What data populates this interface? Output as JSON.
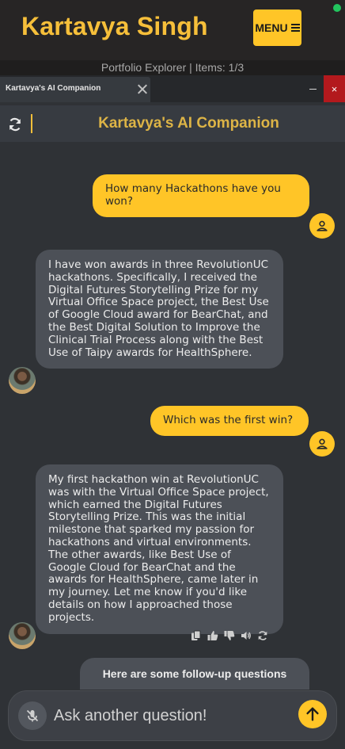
{
  "app": {
    "brand": "Kartavya Singh",
    "menu_label": "MENU",
    "subtitle": "Portfolio Explorer | Items: 1/3"
  },
  "window": {
    "tab_title": "Kartavya's AI Companion",
    "minimize_glyph": "–",
    "close_glyph": "×"
  },
  "chat": {
    "header_title": "Kartavya's AI Companion",
    "messages": [
      {
        "role": "user",
        "text": "How many Hackathons have you won?"
      },
      {
        "role": "bot",
        "text": "I have won awards in three RevolutionUC hackathons. Specifically, I received the Digital Futures Storytelling Prize for my Virtual Office Space project, the Best Use of Google Cloud award for BearChat, and the Best Digital Solution to Improve the Clinical Trial Process along with the Best Use of Taipy awards for HealthSphere."
      },
      {
        "role": "user",
        "text": "Which was the first win?"
      },
      {
        "role": "bot",
        "text": "My first hackathon win at RevolutionUC was with the Virtual Office Space project, which earned the Digital Futures Storytelling Prize. This was the initial milestone that sparked my passion for hackathons and virtual environments. The other awards, like Best Use of Google Cloud for BearChat and the awards for HealthSphere, came later in my journey. Let me know if you'd like details on how I approached those projects."
      }
    ],
    "action_icons": [
      "copy-icon",
      "thumbs-up-icon",
      "thumbs-down-icon",
      "speaker-icon",
      "regenerate-icon"
    ],
    "followup_heading": "Here are some follow-up questions",
    "input": {
      "placeholder": "Ask another question!",
      "value": ""
    }
  },
  "colors": {
    "accent": "#ffc527",
    "brand_text": "#f6bf3a",
    "close_red": "#b3191d",
    "status_green": "#22c55e",
    "bot_bubble": "#4c5057"
  },
  "status": {
    "online": true
  }
}
